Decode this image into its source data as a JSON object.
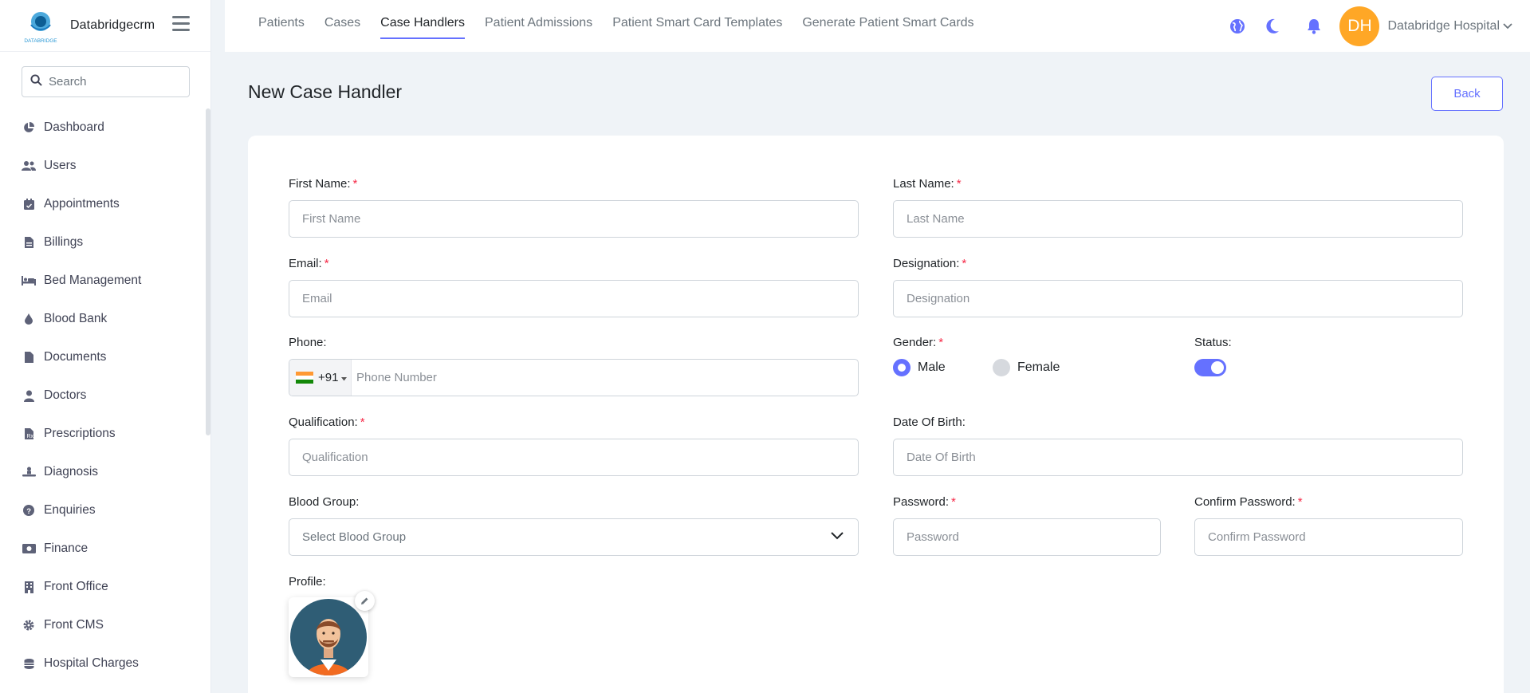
{
  "brand": {
    "name": "Databridgecrm",
    "logo_text": "DATABRIDGE"
  },
  "sidebar": {
    "search_placeholder": "Search",
    "items": [
      {
        "label": "Dashboard",
        "icon": "pie-chart-icon"
      },
      {
        "label": "Users",
        "icon": "users-icon"
      },
      {
        "label": "Appointments",
        "icon": "calendar-check-icon"
      },
      {
        "label": "Billings",
        "icon": "invoice-icon"
      },
      {
        "label": "Bed Management",
        "icon": "bed-icon"
      },
      {
        "label": "Blood Bank",
        "icon": "blood-drop-icon"
      },
      {
        "label": "Documents",
        "icon": "file-icon"
      },
      {
        "label": "Doctors",
        "icon": "doctor-icon"
      },
      {
        "label": "Prescriptions",
        "icon": "prescription-icon"
      },
      {
        "label": "Diagnosis",
        "icon": "diagnosis-icon"
      },
      {
        "label": "Enquiries",
        "icon": "question-circle-icon"
      },
      {
        "label": "Finance",
        "icon": "money-icon"
      },
      {
        "label": "Front Office",
        "icon": "building-icon"
      },
      {
        "label": "Front CMS",
        "icon": "gear-icon"
      },
      {
        "label": "Hospital Charges",
        "icon": "coins-icon"
      }
    ]
  },
  "topbar": {
    "tabs": [
      {
        "label": "Patients",
        "active": false
      },
      {
        "label": "Cases",
        "active": false
      },
      {
        "label": "Case Handlers",
        "active": true
      },
      {
        "label": "Patient Admissions",
        "active": false
      },
      {
        "label": "Patient Smart Card Templates",
        "active": false
      },
      {
        "label": "Generate Patient Smart Cards",
        "active": false
      }
    ],
    "user_initials": "DH",
    "user_name": "Databridge Hospital"
  },
  "page": {
    "title": "New Case Handler",
    "back_label": "Back"
  },
  "form": {
    "first_name": {
      "label": "First Name:",
      "placeholder": "First Name",
      "required": "*"
    },
    "last_name": {
      "label": "Last Name:",
      "placeholder": "Last Name",
      "required": "*"
    },
    "email": {
      "label": "Email:",
      "placeholder": "Email",
      "required": "*"
    },
    "designation": {
      "label": "Designation:",
      "placeholder": "Designation",
      "required": "*"
    },
    "phone": {
      "label": "Phone:",
      "dial_code": "+91",
      "placeholder": "Phone Number"
    },
    "gender": {
      "label": "Gender:",
      "required": "*",
      "options": [
        "Male",
        "Female"
      ],
      "selected": "Male"
    },
    "status": {
      "label": "Status:",
      "enabled": true
    },
    "qualification": {
      "label": "Qualification:",
      "placeholder": "Qualification",
      "required": "*"
    },
    "dob": {
      "label": "Date Of Birth:",
      "placeholder": "Date Of Birth"
    },
    "blood_group": {
      "label": "Blood Group:",
      "placeholder": "Select Blood Group"
    },
    "password": {
      "label": "Password:",
      "placeholder": "Password",
      "required": "*"
    },
    "confirm_password": {
      "label": "Confirm Password:",
      "placeholder": "Confirm Password",
      "required": "*"
    },
    "profile": {
      "label": "Profile:"
    }
  },
  "colors": {
    "accent": "#6571ff",
    "avatar_bg": "#ffa726",
    "required": "#f62947"
  }
}
